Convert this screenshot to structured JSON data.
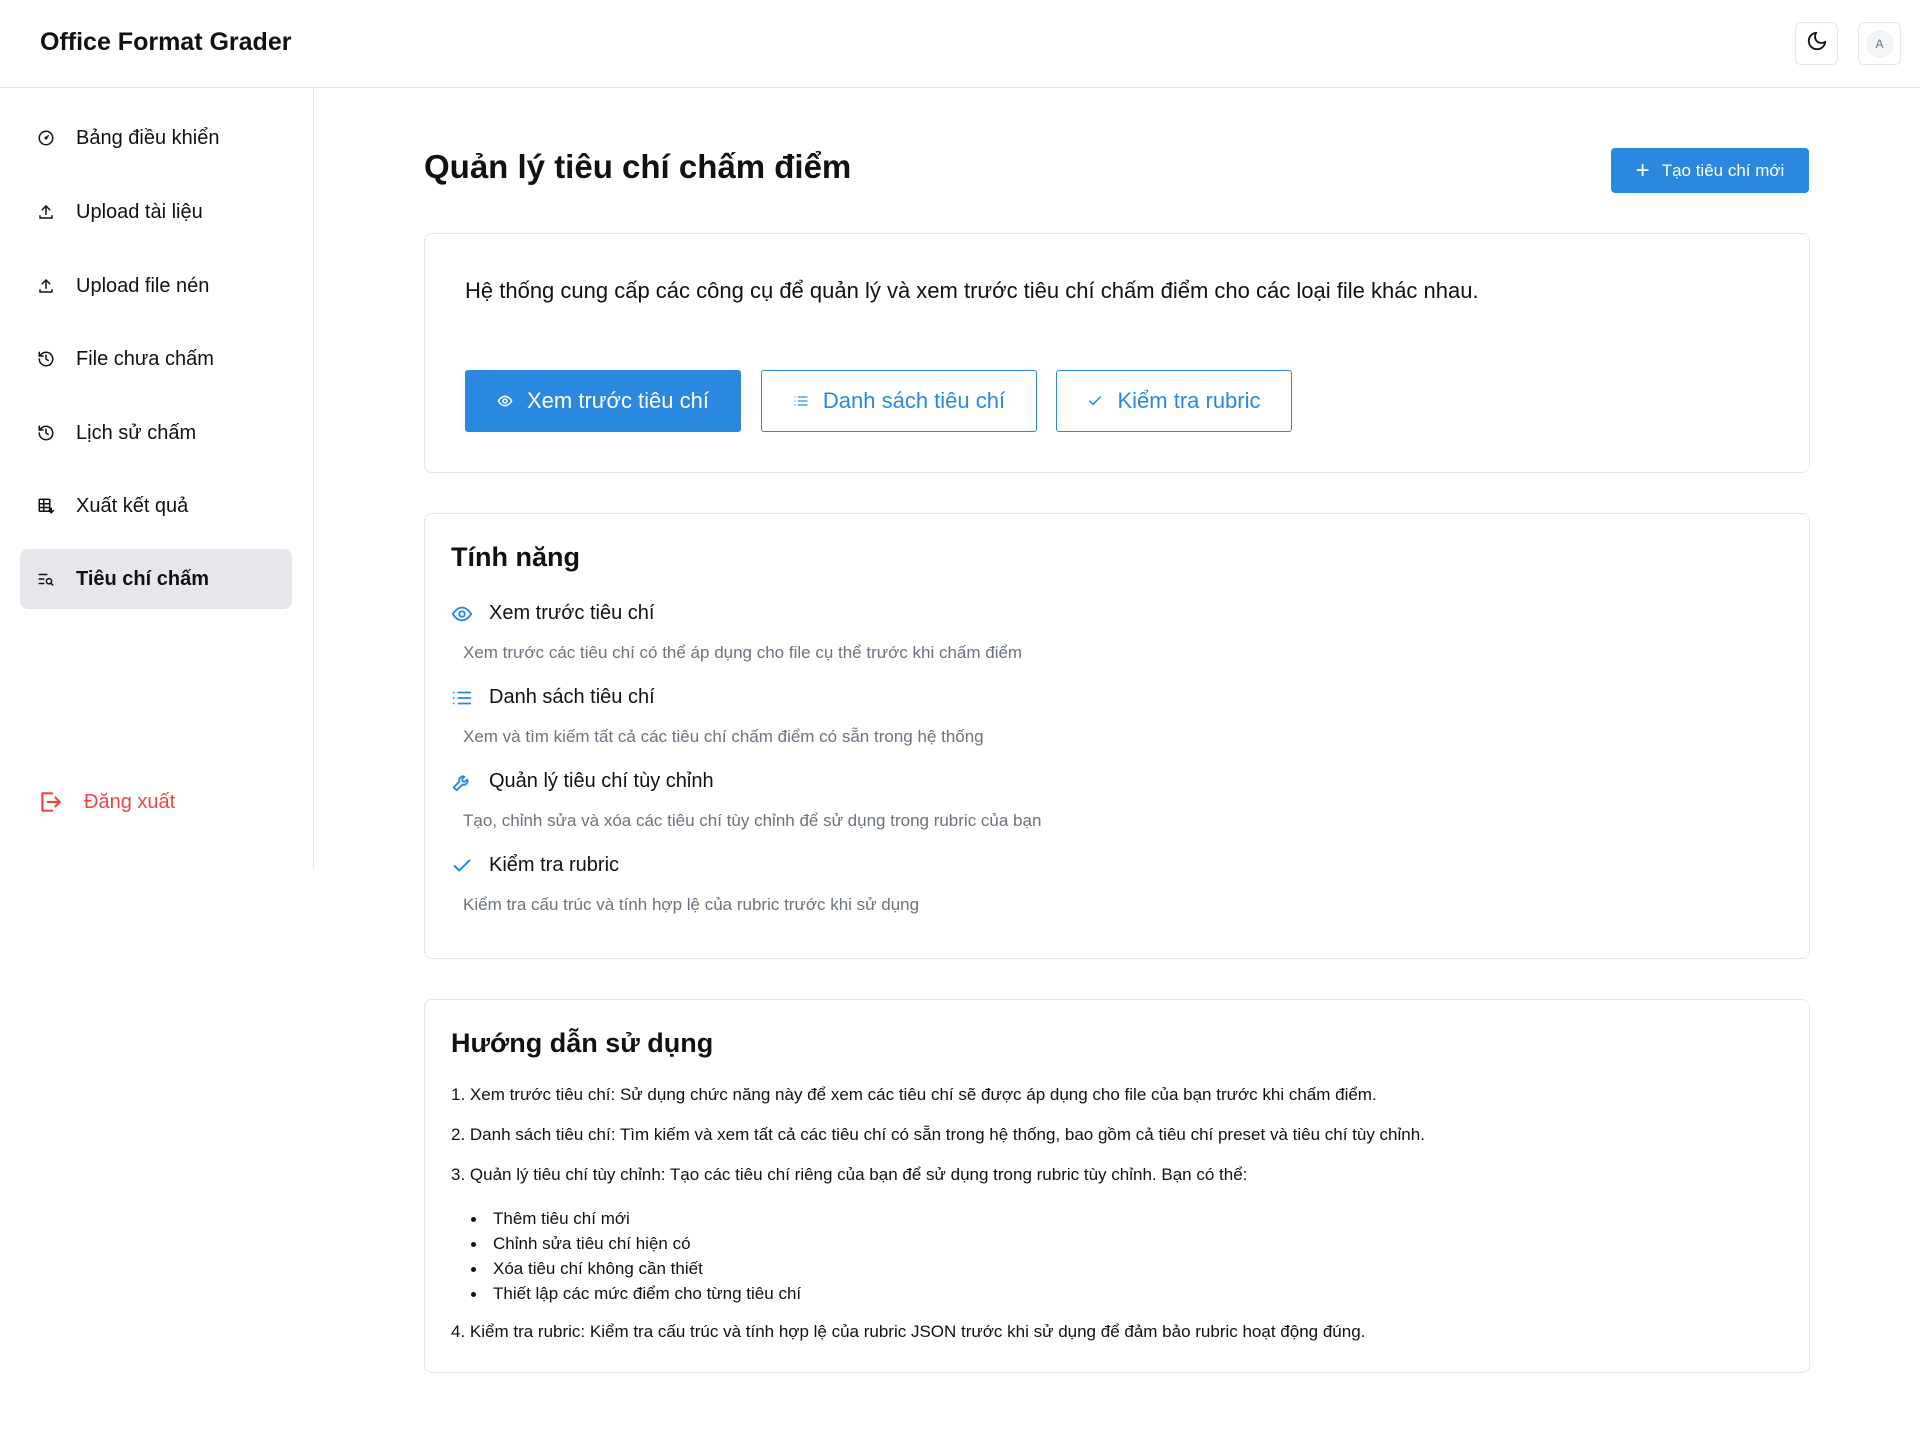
{
  "app": {
    "title": "Office Format Grader",
    "avatar_initial": "A"
  },
  "sidebar": {
    "items": [
      {
        "label": "Bảng điều khiển",
        "icon": "gauge-icon"
      },
      {
        "label": "Upload tài liệu",
        "icon": "upload-icon"
      },
      {
        "label": "Upload file nén",
        "icon": "upload-icon"
      },
      {
        "label": "File chưa chấm",
        "icon": "history-icon"
      },
      {
        "label": "Lịch sử chấm",
        "icon": "history-icon"
      },
      {
        "label": "Xuất kết quả",
        "icon": "table-export-icon"
      },
      {
        "label": "Tiêu chí chấm",
        "icon": "list-search-icon",
        "active": true
      }
    ],
    "logout_label": "Đăng xuất"
  },
  "main": {
    "title": "Quản lý tiêu chí chấm điểm",
    "create_button": "Tạo tiêu chí mới",
    "intro": "Hệ thống cung cấp các công cụ để quản lý và xem trước tiêu chí chấm điểm cho các loại file khác nhau.",
    "tabs": [
      {
        "label": "Xem trước tiêu chí",
        "icon": "eye-icon",
        "selected": true
      },
      {
        "label": "Danh sách tiêu chí",
        "icon": "list-icon",
        "selected": false
      },
      {
        "label": "Kiểm tra rubric",
        "icon": "check-icon",
        "selected": false
      }
    ],
    "features": {
      "title": "Tính năng",
      "items": [
        {
          "title": "Xem trước tiêu chí",
          "desc": "Xem trước các tiêu chí có thể áp dụng cho file cụ thể trước khi chấm điểm",
          "icon": "eye-icon"
        },
        {
          "title": "Danh sách tiêu chí",
          "desc": "Xem và tìm kiếm tất cả các tiêu chí chấm điểm có sẵn trong hệ thống",
          "icon": "list-icon"
        },
        {
          "title": "Quản lý tiêu chí tùy chỉnh",
          "desc": "Tạo, chỉnh sửa và xóa các tiêu chí tùy chỉnh để sử dụng trong rubric của bạn",
          "icon": "wrench-icon"
        },
        {
          "title": "Kiểm tra rubric",
          "desc": "Kiểm tra cấu trúc và tính hợp lệ của rubric trước khi sử dụng",
          "icon": "check-icon"
        }
      ]
    },
    "guide": {
      "title": "Hướng dẫn sử dụng",
      "step1": "1. Xem trước tiêu chí: Sử dụng chức năng này để xem các tiêu chí sẽ được áp dụng cho file của bạn trước khi chấm điểm.",
      "step2": "2. Danh sách tiêu chí: Tìm kiếm và xem tất cả các tiêu chí có sẵn trong hệ thống, bao gồm cả tiêu chí preset và tiêu chí tùy chỉnh.",
      "step3": "3. Quản lý tiêu chí tùy chỉnh: Tạo các tiêu chí riêng của bạn để sử dụng trong rubric tùy chỉnh. Bạn có thể:",
      "bullets": [
        "Thêm tiêu chí mới",
        "Chỉnh sửa tiêu chí hiện có",
        "Xóa tiêu chí không cần thiết",
        "Thiết lập các mức điểm cho từng tiêu chí"
      ],
      "step4": "4. Kiểm tra rubric: Kiểm tra cấu trúc và tính hợp lệ của rubric JSON trước khi sử dụng để đảm bảo rubric hoạt động đúng."
    }
  },
  "colors": {
    "accent": "#2b88e0",
    "danger": "#ef4444",
    "muted": "#6b7280",
    "border": "#e5e7eb",
    "active_bg": "#e5e7eb"
  }
}
